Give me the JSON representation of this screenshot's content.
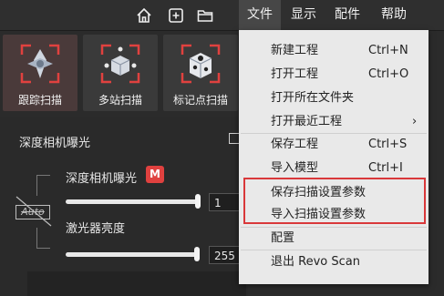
{
  "topbar": {
    "icons": [
      "home-icon",
      "add-icon",
      "folder-icon"
    ],
    "menus": [
      {
        "label": "文件",
        "active": true
      },
      {
        "label": "显示",
        "active": false
      },
      {
        "label": "配件",
        "active": false
      },
      {
        "label": "帮助",
        "active": false
      }
    ]
  },
  "modes": [
    {
      "label": "跟踪扫描",
      "active": true
    },
    {
      "label": "多站扫描",
      "active": false
    },
    {
      "label": "标记点扫描",
      "active": false
    }
  ],
  "panel": {
    "title": "深度相机曝光",
    "exposure_label": "深度相机曝光",
    "manual_badge": "M",
    "exposure_value": "1",
    "auto_label": "Auto",
    "laser_label": "激光器亮度",
    "laser_value": "255"
  },
  "file_menu": {
    "items": [
      {
        "label": "新建工程",
        "shortcut": "Ctrl+N"
      },
      {
        "label": "打开工程",
        "shortcut": "Ctrl+O"
      },
      {
        "label": "打开所在文件夹",
        "shortcut": ""
      },
      {
        "label": "打开最近工程",
        "shortcut": "",
        "arrow": "›"
      },
      {
        "label": "保存工程",
        "shortcut": "Ctrl+S"
      },
      {
        "label": "导入模型",
        "shortcut": "Ctrl+I"
      },
      {
        "label": "保存扫描设置参数",
        "shortcut": ""
      },
      {
        "label": "导入扫描设置参数",
        "shortcut": ""
      },
      {
        "label": "配置",
        "shortcut": ""
      },
      {
        "label": "退出 Revo Scan",
        "shortcut": ""
      }
    ]
  },
  "colors": {
    "accent_red": "#d9383a",
    "menu_bg": "#e9e9e9",
    "dark_bg": "#2b2b2b"
  }
}
